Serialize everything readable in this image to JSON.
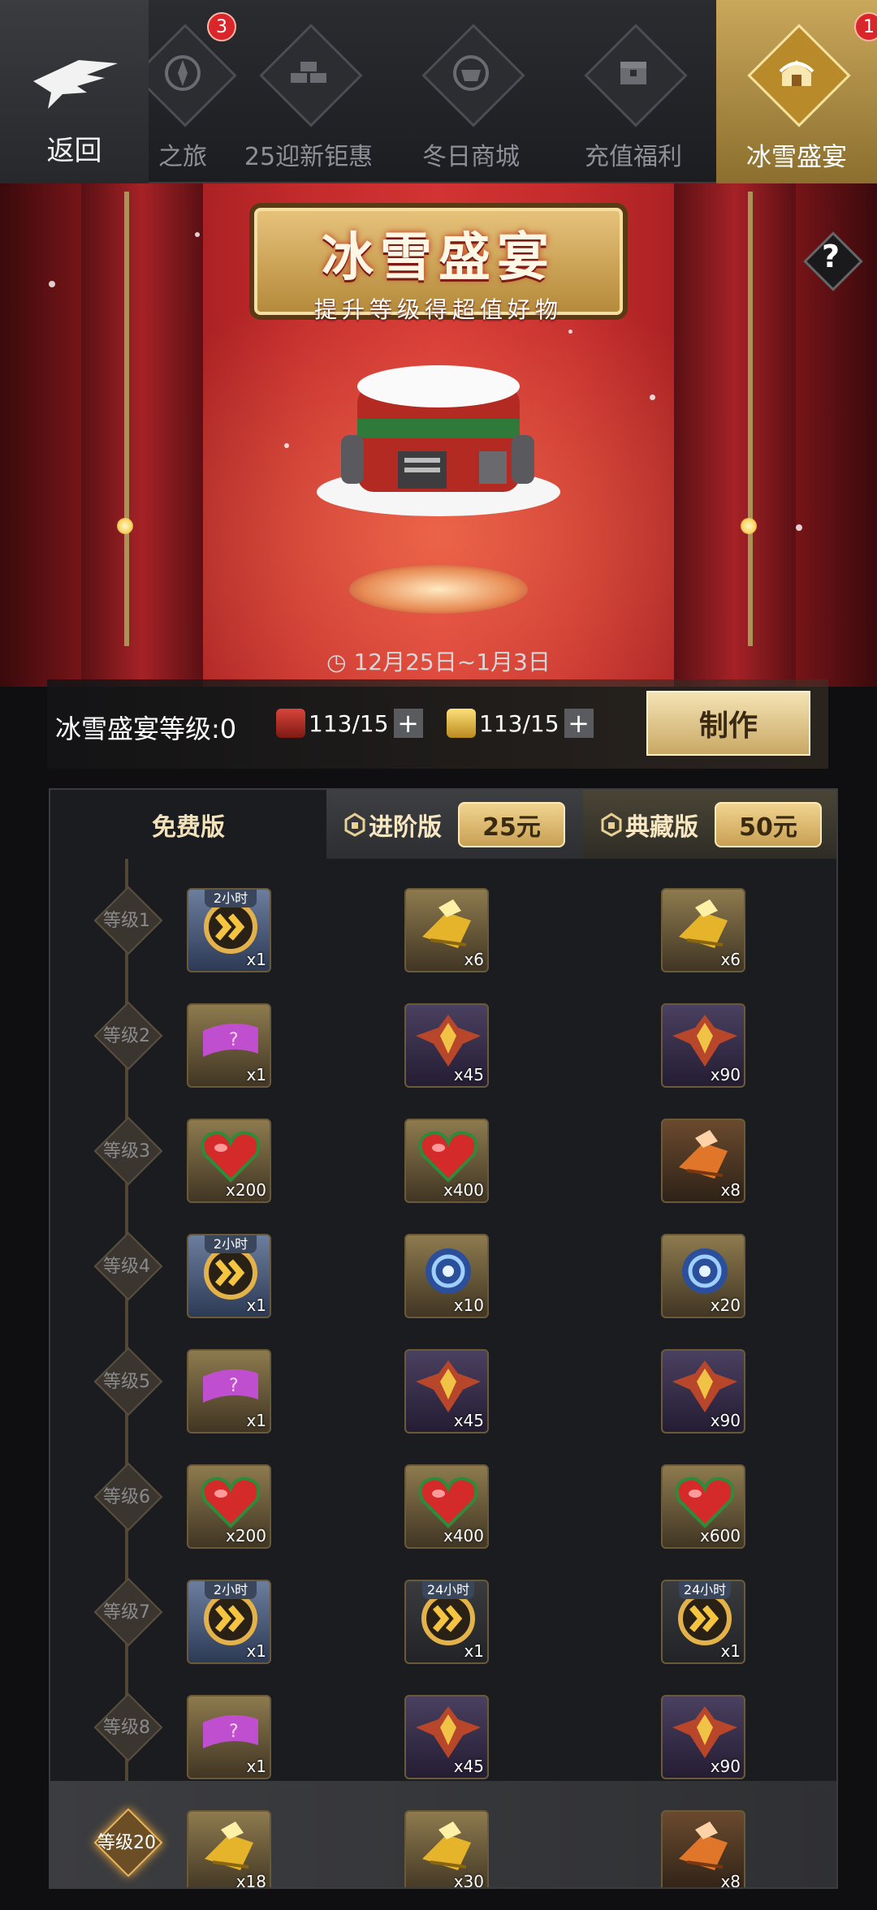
{
  "nav": {
    "back_label": "返回",
    "tabs": [
      {
        "label": "之旅",
        "badge": "3",
        "icon": "compass-icon",
        "active": false
      },
      {
        "label": "25迎新钜惠",
        "icon": "gold-bars-icon",
        "active": false
      },
      {
        "label": "冬日商城",
        "icon": "shop-icon",
        "active": false
      },
      {
        "label": "充值福利",
        "icon": "treasure-chest-icon",
        "active": false
      },
      {
        "label": "冰雪盛宴",
        "badge": "1",
        "icon": "snow-house-icon",
        "active": true
      }
    ]
  },
  "banner": {
    "title": "冰雪盛宴",
    "subtitle": "提升等级得超值好物",
    "date_range": "12月25日~1月3日",
    "help_icon": "question-icon"
  },
  "level_bar": {
    "level_label": "冰雪盛宴等级:0",
    "resources": [
      {
        "icon": "red-box-icon",
        "value": "113/15"
      },
      {
        "icon": "gold-box-icon",
        "value": "113/15"
      }
    ],
    "make_label": "制作"
  },
  "columns": {
    "free": {
      "label": "免费版"
    },
    "advanced": {
      "label": "进阶版",
      "price": "25元"
    },
    "collector": {
      "label": "典藏版",
      "price": "50元"
    }
  },
  "rows": [
    {
      "level": "等级1",
      "free": {
        "icon": "speedup-chevron-icon",
        "qty": "x1",
        "tag": "2小时",
        "bg": "blue"
      },
      "adv": {
        "icon": "gold-mecha-icon",
        "qty": "x6",
        "bg": "gold"
      },
      "col": {
        "icon": "gold-mecha-icon",
        "qty": "x6",
        "bg": "gold"
      }
    },
    {
      "level": "等级2",
      "free": {
        "icon": "purple-ticket-icon",
        "qty": "x1",
        "bg": "gold"
      },
      "adv": {
        "icon": "winged-emblem-icon",
        "qty": "x45",
        "bg": "purple"
      },
      "col": {
        "icon": "winged-emblem-icon",
        "qty": "x90",
        "bg": "purple"
      }
    },
    {
      "level": "等级3",
      "free": {
        "icon": "heart-icon",
        "qty": "x200",
        "bg": "gold"
      },
      "adv": {
        "icon": "heart-icon",
        "qty": "x400",
        "bg": "gold"
      },
      "col": {
        "icon": "orange-mecha-icon",
        "qty": "x8",
        "bg": "orange"
      }
    },
    {
      "level": "等级4",
      "free": {
        "icon": "speedup-chevron-icon",
        "qty": "x1",
        "tag": "2小时",
        "bg": "blue"
      },
      "adv": {
        "icon": "blue-vortex-icon",
        "qty": "x10",
        "bg": "gold"
      },
      "col": {
        "icon": "blue-vortex-icon",
        "qty": "x20",
        "bg": "gold"
      }
    },
    {
      "level": "等级5",
      "free": {
        "icon": "purple-ticket-icon",
        "qty": "x1",
        "bg": "gold"
      },
      "adv": {
        "icon": "winged-emblem-icon",
        "qty": "x45",
        "bg": "purple"
      },
      "col": {
        "icon": "winged-emblem-icon",
        "qty": "x90",
        "bg": "purple"
      }
    },
    {
      "level": "等级6",
      "free": {
        "icon": "heart-icon",
        "qty": "x200",
        "bg": "gold"
      },
      "adv": {
        "icon": "heart-icon",
        "qty": "x400",
        "bg": "gold"
      },
      "col": {
        "icon": "heart-icon",
        "qty": "x600",
        "bg": "gold"
      }
    },
    {
      "level": "等级7",
      "free": {
        "icon": "speedup-chevron-icon",
        "qty": "x1",
        "tag": "2小时",
        "bg": "blue"
      },
      "adv": {
        "icon": "speedup-chevron-icon",
        "qty": "x1",
        "tag": "24小时",
        "bg": "dark"
      },
      "col": {
        "icon": "speedup-chevron-icon",
        "qty": "x1",
        "tag": "24小时",
        "bg": "dark"
      }
    },
    {
      "level": "等级8",
      "free": {
        "icon": "purple-ticket-icon",
        "qty": "x1",
        "bg": "gold"
      },
      "adv": {
        "icon": "winged-emblem-icon",
        "qty": "x45",
        "bg": "purple"
      },
      "col": {
        "icon": "winged-emblem-icon",
        "qty": "x90",
        "bg": "purple"
      }
    },
    {
      "level": "等级20",
      "highlight": true,
      "free": {
        "icon": "gold-mecha-icon",
        "qty": "x18",
        "bg": "gold"
      },
      "adv": {
        "icon": "gold-mecha-icon",
        "qty": "x30",
        "bg": "gold"
      },
      "col": {
        "icon": "orange-mecha-icon",
        "qty": "x8",
        "bg": "orange"
      }
    }
  ]
}
